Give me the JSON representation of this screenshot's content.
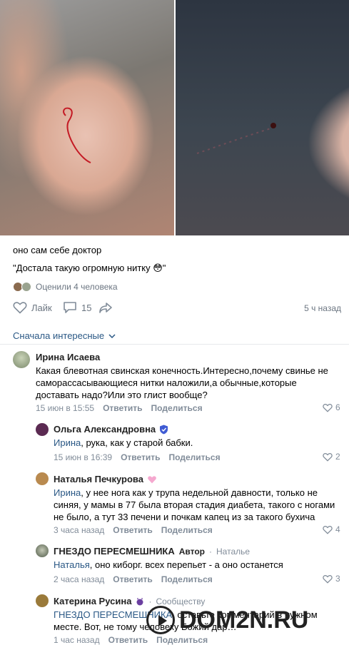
{
  "post": {
    "line1": "оно сам себе доктор",
    "line2": "\"Достала такую огромную нитку 😳\"",
    "liked_by": "Оценили 4 человека",
    "like_label": "Лайк",
    "comments_count": "15",
    "time": "5 ч назад"
  },
  "sort_label": "Сначала интересные",
  "comments": [
    {
      "author": "Ирина Исаева",
      "text": "Какая блевотная свинская конечность.Интересно,почему свинье не саморассасывающиеся нитки наложили,а обычные,которые доставать надо?Или это глист вообще?",
      "date": "15 июн в 15:55",
      "reply": "Ответить",
      "share": "Поделиться",
      "likes": "6"
    },
    {
      "author": "Ольга Александровна",
      "mention": "Ирина",
      "text": ", рука, как у старой бабки.",
      "date": "15 июн в 16:39",
      "reply": "Ответить",
      "share": "Поделиться",
      "likes": "2"
    },
    {
      "author": "Наталья Печкурова",
      "mention": "Ирина",
      "text": ", у нее нога как у трупа недельной давности, только не синяя, у мамы в 77 была вторая стадия диабета, такого с ногами не было, а тут 33 печени и почкам капец из за такого бухича",
      "date": "3 часа назад",
      "reply": "Ответить",
      "share": "Поделиться",
      "likes": "4"
    },
    {
      "author": "ГНЕЗДО ПЕРЕСМЕШНИКА",
      "author_tag": "Автор",
      "reply_to": "Наталье",
      "mention": "Наталья",
      "text": ", оно киборг. всех перепьет - а оно останется",
      "date": "2 часа назад",
      "reply": "Ответить",
      "share": "Поделиться",
      "likes": "3"
    },
    {
      "author": "Катерина Русина",
      "reply_to": "Сообществу",
      "mention": "ГНЕЗДО ПЕРЕСМЕШНИКА",
      "text": ", оставьте комментарий в нужном месте. Вот, не тому человеку Божий дар…",
      "date": "1 час назад",
      "reply": "Ответить",
      "share": "Поделиться"
    }
  ],
  "watermark": "DOM2N.RU",
  "colors": {
    "link": "#2a5885",
    "meta": "#818c99",
    "badge": "#3f5bd3"
  }
}
